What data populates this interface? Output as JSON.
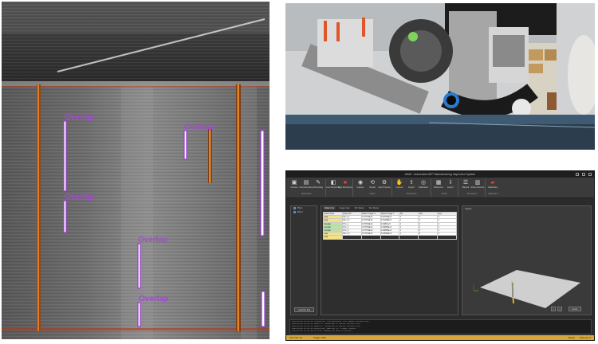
{
  "scan": {
    "overlap_label": "Overlap",
    "overlaps_count_shown": 5
  },
  "app": {
    "title": "AIMS - Automated AFP Manufacturing Inspection System",
    "ribbon": {
      "groups": [
        {
          "name": "Multimedia",
          "buttons": [
            "Camera",
            "File Recording",
            "Recording"
          ]
        },
        {
          "name": "",
          "buttons": [
            "Live Monitoring",
            "Stop Monitoring"
          ]
        },
        {
          "name": "Vision",
          "buttons": [
            "Capture",
            "Recall",
            "Auto Process"
          ]
        },
        {
          "name": "Dependent",
          "buttons": [
            "Capture",
            "Export",
            "Calibration"
          ]
        },
        {
          "name": "Defect",
          "buttons": [
            "Reference",
            "Export"
          ]
        },
        {
          "name": "Tool layout",
          "buttons": [
            "Manual",
            "Show Sections"
          ]
        },
        {
          "name": "Calibration",
          "buttons": [
            "Calibration"
          ]
        }
      ]
    },
    "tree": [
      "Ply 1",
      "Ply 2"
    ],
    "load_button": "Load NC File",
    "tabs": [
      "Defect List",
      "Image View",
      "Ply Status",
      "Tow Status"
    ],
    "viewer_label": "Viewer",
    "home_button": "Home",
    "table": {
      "headers": [
        "Defect Type",
        "Defect ID",
        "Defect Image X",
        "Defect Image Y",
        "Ply",
        "Tow",
        "Seq"
      ],
      "rows": [
        [
          "Gap",
          "Mn-1_1",
          "0.70734E+5",
          "0.30734E+5",
          "1",
          "1",
          "1"
        ],
        [
          "Gap",
          "Mn-1_2",
          "0.70734E+5",
          "0.31248E+5",
          "1",
          "2",
          "1"
        ],
        [
          "Overlap",
          "Pl-1_1",
          "0.70734E+5",
          "0.3281E+5",
          "1",
          "3",
          "1"
        ],
        [
          "Overlap",
          "Pl-1_2",
          "0.70734E+5",
          "0.32849E+5",
          "1",
          "4",
          "1"
        ],
        [
          "Overlap",
          "Pl-1_3",
          "0.70734E+5",
          "0.32849E+5",
          "1",
          "5",
          "1"
        ],
        [
          "Gap",
          "Mn-1_3",
          "0.70734E+5",
          "0.33049E+5",
          "1",
          "6",
          "1"
        ],
        [
          "Gap",
          "Mn-1_4",
          "0.70734E+5",
          "0.33204E+5",
          "1",
          "7",
          "1"
        ]
      ]
    },
    "log": [
      "2024-04-02 16:22:11 Initialize: Configuration file loaded successfully.",
      "2024-04-02 16:22:11 Camera 1: Connected to device successfully.",
      "2024-04-02 16:22:12 Camera 2: Connected to device successfully.",
      "2024-04-02 16:22:13 Monitoring: Waiting for trigger signal.",
      "2024-04-02 16:22:14 NC File: Loaded ply data (2 plies)."
    ],
    "status": {
      "left1": "CTS: 5F / 22",
      "left2": "Trigger: OFF",
      "right1": "Ready",
      "right2": "Inference ●"
    }
  }
}
